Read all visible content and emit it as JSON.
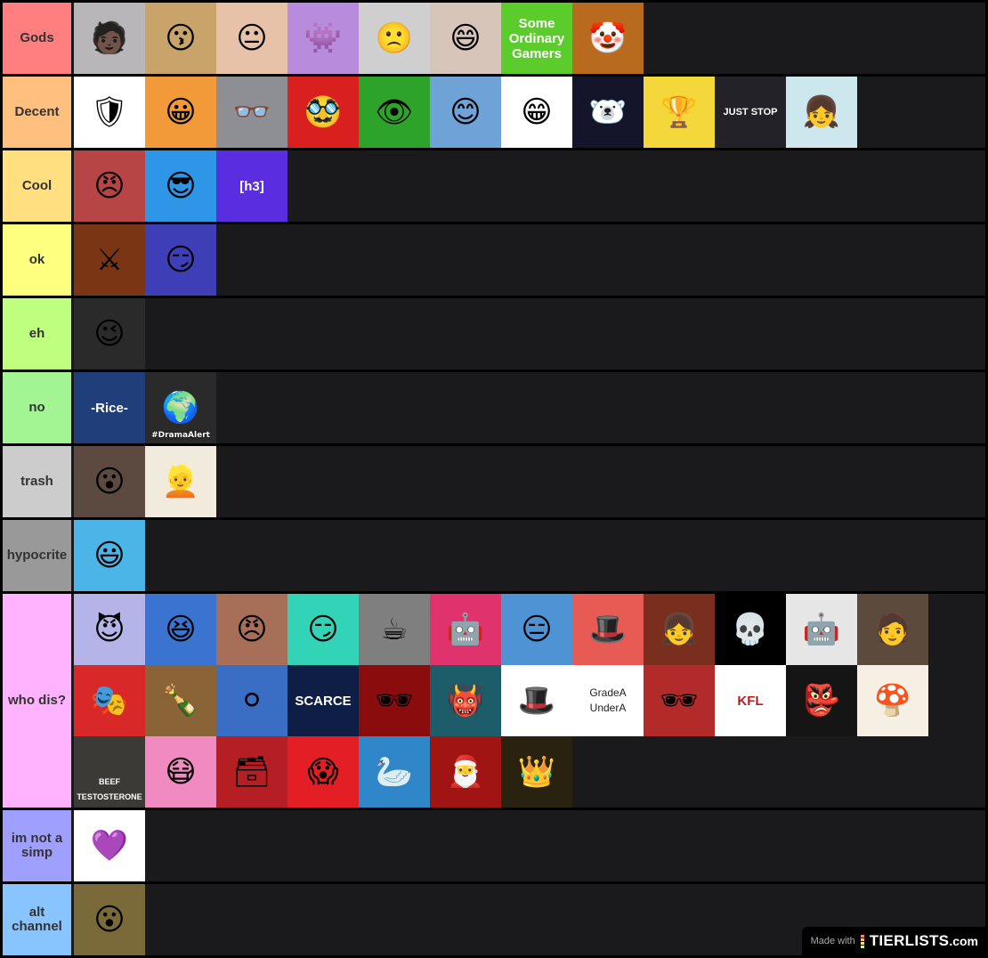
{
  "tiers": [
    {
      "label": "Gods",
      "color": "#ff7f7f",
      "items": [
        {
          "name": "rapper-bandana-photo",
          "bg": "#b8b6b8",
          "glyph": "🧑🏿",
          "caption": ""
        },
        {
          "name": "round-face-photo",
          "bg": "#c9a46a",
          "glyph": "😗",
          "caption": ""
        },
        {
          "name": "close-up-face-photo",
          "bg": "#e8c2a8",
          "glyph": "😐",
          "caption": ""
        },
        {
          "name": "pink-cube-monster-art",
          "bg": "#b98bdd",
          "glyph": "👾",
          "caption": ""
        },
        {
          "name": "cartoon-sad-boy",
          "bg": "#cfcfcf",
          "glyph": "🙁",
          "caption": ""
        },
        {
          "name": "smiling-man-photo",
          "bg": "#d7c5b9",
          "glyph": "😄",
          "caption": ""
        },
        {
          "name": "some-ordinary-gamers-logo",
          "bg": "#5bcc2b",
          "glyph": "",
          "caption": "Some Ordinary Gamers"
        },
        {
          "name": "evil-clown-art",
          "bg": "#b86a1e",
          "glyph": "🤡",
          "caption": ""
        }
      ]
    },
    {
      "label": "Decent",
      "color": "#ffbf7f",
      "items": [
        {
          "name": "green-shield-logo",
          "bg": "#ffffff",
          "glyph": "🛡",
          "caption": ""
        },
        {
          "name": "orange-hair-cartoon",
          "bg": "#f29a3a",
          "glyph": "😀",
          "caption": ""
        },
        {
          "name": "man-glasses-photo",
          "bg": "#8e8e95",
          "glyph": "👓",
          "caption": ""
        },
        {
          "name": "mustache-glasses-cartoon",
          "bg": "#d9201f",
          "glyph": "🥸",
          "caption": ""
        },
        {
          "name": "green-eye-septic",
          "bg": "#2ea32a",
          "glyph": "👁",
          "caption": ""
        },
        {
          "name": "smiling-cartoon-boy",
          "bg": "#6fa2d6",
          "glyph": "😊",
          "caption": ""
        },
        {
          "name": "stick-figure-long-hair",
          "bg": "#ffffff",
          "glyph": "😁",
          "caption": ""
        },
        {
          "name": "white-bear-space",
          "bg": "#14142a",
          "glyph": "🐻‍❄️",
          "caption": ""
        },
        {
          "name": "trophy-theory-logo",
          "bg": "#f4d73b",
          "glyph": "🏆",
          "caption": ""
        },
        {
          "name": "white-hair-just-stop",
          "bg": "#222228",
          "glyph": "",
          "caption": "JUST STOP"
        },
        {
          "name": "purple-shirt-girl-art",
          "bg": "#cde7ee",
          "glyph": "👧",
          "caption": ""
        }
      ]
    },
    {
      "label": "Cool",
      "color": "#ffdf7f",
      "items": [
        {
          "name": "angry-pink-face-art",
          "bg": "#b84545",
          "glyph": "😠",
          "caption": ""
        },
        {
          "name": "black-hair-glasses-art",
          "bg": "#2e96e6",
          "glyph": "😎",
          "caption": ""
        },
        {
          "name": "h3-logo",
          "bg": "#5b2de0",
          "glyph": "",
          "caption": "[h3]"
        }
      ]
    },
    {
      "label": "ok",
      "color": "#ffff7f",
      "items": [
        {
          "name": "armored-knight-art",
          "bg": "#7a3515",
          "glyph": "⚔",
          "caption": ""
        },
        {
          "name": "curly-hair-anime-art",
          "bg": "#3e3fb7",
          "glyph": "😏",
          "caption": ""
        }
      ]
    },
    {
      "label": "eh",
      "color": "#bfff7f",
      "items": [
        {
          "name": "green-elf-wink-art",
          "bg": "#2a2a2a",
          "glyph": "😉",
          "caption": ""
        }
      ]
    },
    {
      "label": "no",
      "color": "#a2f592",
      "items": [
        {
          "name": "rice-gum-photo",
          "bg": "#203f7a",
          "glyph": "",
          "caption": "-Rice-"
        },
        {
          "name": "drama-alert-logo",
          "bg": "#2a2a2a",
          "glyph": "🌍",
          "caption": "#DramaAlert"
        }
      ]
    },
    {
      "label": "trash",
      "color": "#cccccc",
      "items": [
        {
          "name": "surprised-man-photo",
          "bg": "#5c4a40",
          "glyph": "😮",
          "caption": ""
        },
        {
          "name": "blond-man-photo",
          "bg": "#f1ebde",
          "glyph": "👱",
          "caption": ""
        }
      ]
    },
    {
      "label": "hypocrite",
      "color": "#999999",
      "items": [
        {
          "name": "odd-ones-out-character",
          "bg": "#4bb5e8",
          "glyph": "😃",
          "caption": ""
        }
      ]
    },
    {
      "label": "who dis?",
      "color": "#ffb3ff",
      "items": [
        {
          "name": "red-eyes-grin-art",
          "bg": "#b5b4e8",
          "glyph": "😈",
          "caption": ""
        },
        {
          "name": "blue-hair-anime-girl",
          "bg": "#3a74d0",
          "glyph": "😆",
          "caption": ""
        },
        {
          "name": "prisoner-bars-art",
          "bg": "#a76e58",
          "glyph": "😠",
          "caption": ""
        },
        {
          "name": "blue-hat-boy-art",
          "bg": "#32d3b7",
          "glyph": "😏",
          "caption": ""
        },
        {
          "name": "man-in-car-photo",
          "bg": "#7f7f7f",
          "glyph": "☕",
          "caption": ""
        },
        {
          "name": "neon-mech-art",
          "bg": "#e0336e",
          "glyph": "🤖",
          "caption": ""
        },
        {
          "name": "bald-man-coffee-art",
          "bg": "#4e94d4",
          "glyph": "😑",
          "caption": ""
        },
        {
          "name": "top-hat-monocle-art",
          "bg": "#e85b55",
          "glyph": "🎩",
          "caption": ""
        },
        {
          "name": "anime-girl-spirited",
          "bg": "#7a2e1e",
          "glyph": "👧",
          "caption": ""
        },
        {
          "name": "geometric-skull-logo",
          "bg": "#000000",
          "glyph": "💀",
          "caption": ""
        },
        {
          "name": "blue-robot-figure",
          "bg": "#e6e6e6",
          "glyph": "🤖",
          "caption": ""
        },
        {
          "name": "man-side-profile-photo",
          "bg": "#5c4a3c",
          "glyph": "🧑",
          "caption": ""
        },
        {
          "name": "masked-anime-art",
          "bg": "#d82828",
          "glyph": "🎭",
          "caption": ""
        },
        {
          "name": "man-drinking-photo",
          "bg": "#8a6436",
          "glyph": "🍾",
          "caption": ""
        },
        {
          "name": "white-circle-face-logo",
          "bg": "#3a6dc4",
          "glyph": "⚪",
          "caption": ""
        },
        {
          "name": "scarce-logo",
          "bg": "#0e1e44",
          "glyph": "",
          "caption": "SCARCE"
        },
        {
          "name": "red-light-man-photo",
          "bg": "#8a0c0c",
          "glyph": "🕶",
          "caption": ""
        },
        {
          "name": "neon-demon-art",
          "bg": "#1d5d6a",
          "glyph": "👹",
          "caption": ""
        },
        {
          "name": "tophat-smile-drawing",
          "bg": "#ffffff",
          "glyph": "🎩",
          "caption": ""
        },
        {
          "name": "grade-a-under-a-logo",
          "bg": "#ffffff",
          "glyph": "",
          "caption": "GradeA UnderA"
        },
        {
          "name": "hat-sunglasses-cigarette-art",
          "bg": "#b22a2a",
          "glyph": "🕶",
          "caption": ""
        },
        {
          "name": "kfl-logo",
          "bg": "#ffffff",
          "glyph": "",
          "caption": "KFL"
        },
        {
          "name": "green-goblin-skull-art",
          "bg": "#151515",
          "glyph": "👺",
          "caption": ""
        },
        {
          "name": "mushroom-sword-art",
          "bg": "#f6efe4",
          "glyph": "🍄",
          "caption": ""
        },
        {
          "name": "beef-testosterone-photo",
          "bg": "#3b3a36",
          "glyph": "",
          "caption": "BEEF TESTOSTERONE"
        },
        {
          "name": "hooded-mask-art",
          "bg": "#f18ac0",
          "glyph": "😷",
          "caption": ""
        },
        {
          "name": "red-file-box-logo",
          "bg": "#b51e22",
          "glyph": "🗃",
          "caption": ""
        },
        {
          "name": "screaming-cartoon-art",
          "bg": "#e31e24",
          "glyph": "😱",
          "caption": ""
        },
        {
          "name": "white-goose-art",
          "bg": "#2f86c9",
          "glyph": "🦢",
          "caption": ""
        },
        {
          "name": "santa-hat-green-art",
          "bg": "#a01414",
          "glyph": "🎅",
          "caption": ""
        },
        {
          "name": "throne-man-art",
          "bg": "#2a2210",
          "glyph": "👑",
          "caption": ""
        }
      ]
    },
    {
      "label": "im not a simp",
      "color": "#9f9fff",
      "items": [
        {
          "name": "vtuber-anime-girl",
          "bg": "#ffffff",
          "glyph": "💜",
          "caption": ""
        }
      ]
    },
    {
      "label": "alt channel",
      "color": "#88c4ff",
      "items": [
        {
          "name": "round-face-closeup",
          "bg": "#7a6a3a",
          "glyph": "😮",
          "caption": ""
        }
      ]
    }
  ],
  "watermark": {
    "made_with": "Made with",
    "brand": "TIERLISTS",
    "domain": ".com",
    "bar_colors": [
      "#ff7f7f",
      "#ffbf7f",
      "#ffdf7f",
      "#bfff7f"
    ]
  }
}
